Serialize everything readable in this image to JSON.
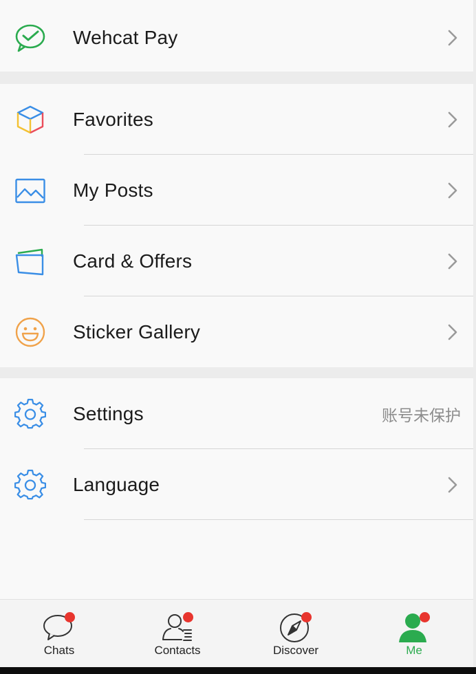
{
  "menu": {
    "pay": {
      "label": "Wehcat Pay",
      "icon": "wechat-pay-icon"
    },
    "favorites": {
      "label": "Favorites",
      "icon": "cube-icon"
    },
    "posts": {
      "label": "My Posts",
      "icon": "image-icon"
    },
    "cards": {
      "label": "Card & Offers",
      "icon": "wallet-card-icon"
    },
    "stickers": {
      "label": "Sticker Gallery",
      "icon": "smiley-icon"
    },
    "settings": {
      "label": "Settings",
      "status": "账号未保护",
      "icon": "gear-icon"
    },
    "language": {
      "label": "Language",
      "icon": "gear-icon"
    }
  },
  "tabbar": {
    "tabs": [
      {
        "label": "Chats",
        "icon": "chat-bubble-icon",
        "badge": true,
        "active": false
      },
      {
        "label": "Contacts",
        "icon": "contacts-icon",
        "badge": true,
        "active": false
      },
      {
        "label": "Discover",
        "icon": "compass-icon",
        "badge": true,
        "active": false
      },
      {
        "label": "Me",
        "icon": "person-icon",
        "badge": true,
        "active": true
      }
    ]
  },
  "colors": {
    "accent_green": "#2bab4f",
    "badge_red": "#e8352e",
    "icon_blue": "#3a8ee6",
    "icon_orange": "#f0a24a"
  }
}
